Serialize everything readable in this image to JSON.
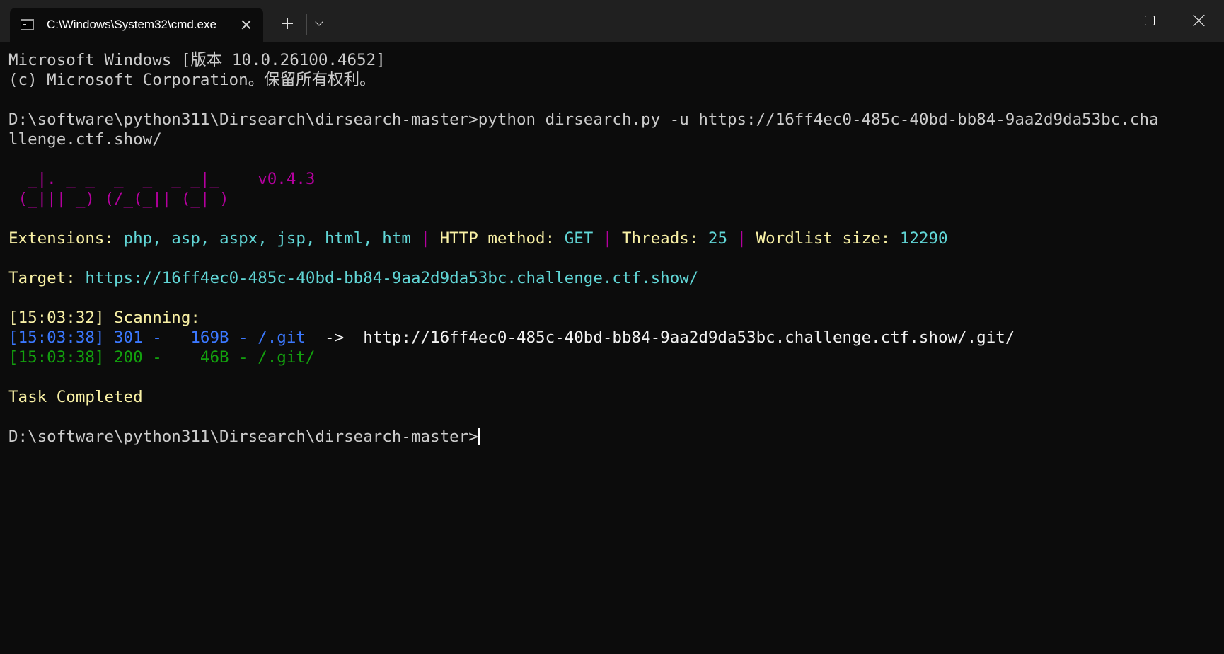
{
  "window": {
    "tab_title": "C:\\Windows\\System32\\cmd.exe",
    "icons": {
      "tab": "cmd-prompt-icon",
      "tab_close": "close-icon",
      "new_tab": "plus-icon",
      "dropdown": "chevron-down-icon",
      "minimize": "minimize-icon",
      "maximize": "maximize-icon",
      "close": "close-icon"
    }
  },
  "colors": {
    "background": "#0c0c0c",
    "titlebar": "#202020",
    "gray": "#cccccc",
    "yellow": "#f9f1a5",
    "cyan": "#61d6d6",
    "magenta": "#b4009e",
    "blue": "#3b78ff",
    "green": "#13a10e"
  },
  "terminal": {
    "header_line1": "Microsoft Windows [版本 10.0.26100.4652]",
    "header_line2": "(c) Microsoft Corporation。保留所有权利。",
    "command_line1": "D:\\software\\python311\\Dirsearch\\dirsearch-master>python dirsearch.py -u https://16ff4ec0-485c-40bd-bb84-9aa2d9da53bc.cha",
    "command_line2": "llenge.ctf.show/",
    "banner_line1": "  _|. _ _  _  _  _ _|_    v0.4.3",
    "banner_line2": " (_||| _) (/_(_|| (_| )",
    "config": {
      "extensions_label": "Extensions: ",
      "extensions_value": "php, asp, aspx, jsp, html, htm",
      "separator": " | ",
      "method_label": "HTTP method: ",
      "method_value": "GET",
      "threads_label": "Threads: ",
      "threads_value": "25",
      "wordlist_label": "Wordlist size: ",
      "wordlist_value": "12290"
    },
    "target_label": "Target: ",
    "target_value": "https://16ff4ec0-485c-40bd-bb84-9aa2d9da53bc.challenge.ctf.show/",
    "scanning_line": "[15:03:32] Scanning:",
    "results": [
      {
        "text": "[15:03:38] 301 -   169B - /.git",
        "redirect": "  ->  http://16ff4ec0-485c-40bd-bb84-9aa2d9da53bc.challenge.ctf.show/.git/"
      },
      {
        "text": "[15:03:38] 200 -    46B - /.git/"
      }
    ],
    "task_completed": "Task Completed",
    "prompt": "D:\\software\\python311\\Dirsearch\\dirsearch-master>"
  }
}
